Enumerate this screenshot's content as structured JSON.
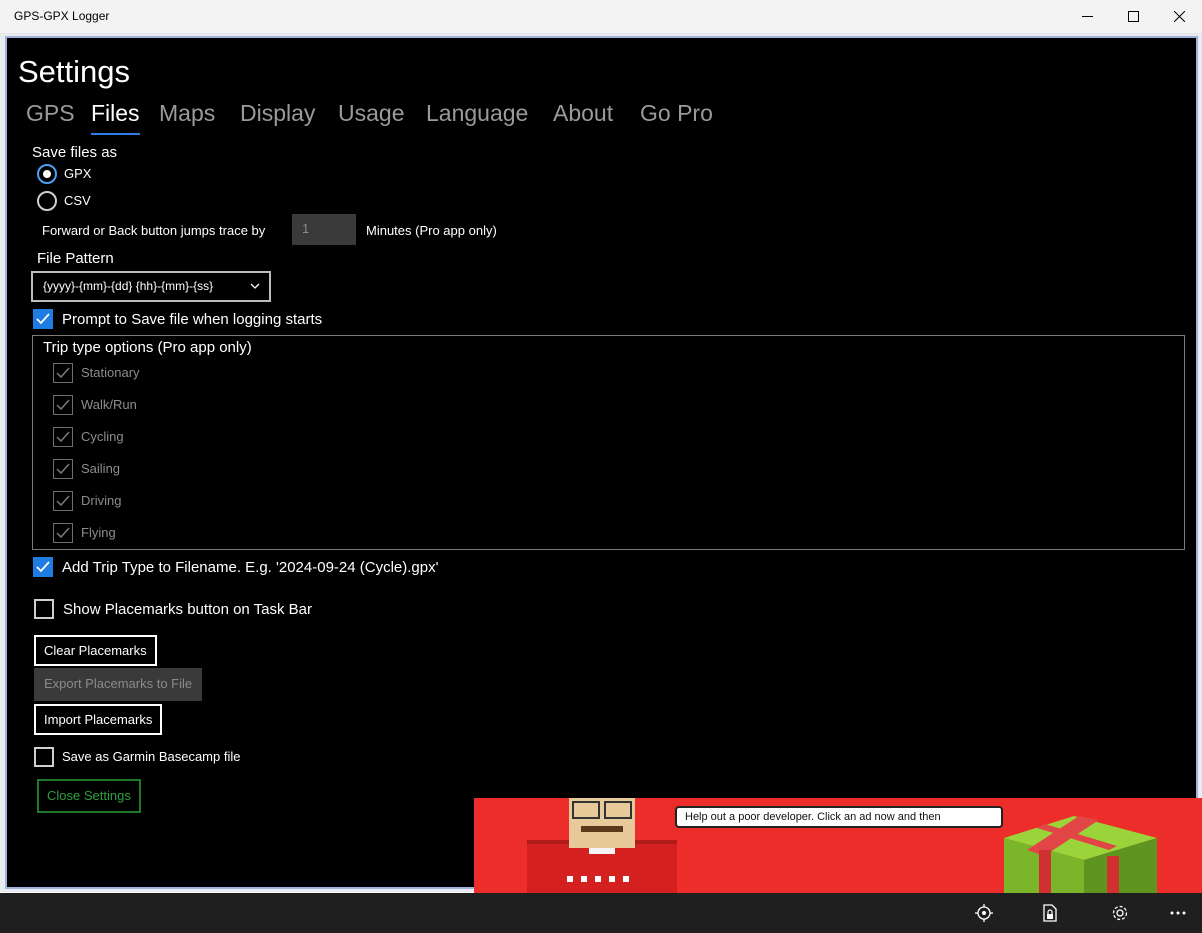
{
  "app": {
    "title": "GPS-GPX Logger"
  },
  "page": {
    "title": "Settings"
  },
  "tabs": [
    "GPS",
    "Files",
    "Maps",
    "Display",
    "Usage",
    "Language",
    "About",
    "Go Pro"
  ],
  "active_tab": "Files",
  "save_files": {
    "label": "Save files as",
    "options": [
      "GPX",
      "CSV"
    ],
    "selected": "GPX"
  },
  "jump": {
    "prefix": "Forward or Back button jumps trace by",
    "value": "1",
    "suffix": "Minutes (Pro app only)"
  },
  "file_pattern": {
    "label": "File Pattern",
    "value": "{yyyy}-{mm}-{dd} {hh}-{mm}-{ss}"
  },
  "prompt_save": {
    "label": "Prompt to Save file when logging starts",
    "checked": true
  },
  "trip_types": {
    "title": "Trip type options (Pro app only)",
    "items": [
      "Stationary",
      "Walk/Run",
      "Cycling",
      "Sailing",
      "Driving",
      "Flying"
    ]
  },
  "add_trip_type": {
    "label": "Add Trip Type to Filename. E.g. '2024-09-24 (Cycle).gpx'",
    "checked": true
  },
  "show_placemarks": {
    "label": "Show Placemarks button on Task Bar",
    "checked": false
  },
  "buttons": {
    "clear": "Clear Placemarks",
    "export": "Export Placemarks to File",
    "import": "Import Placemarks",
    "close": "Close Settings"
  },
  "garmin": {
    "label": "Save as Garmin Basecamp file",
    "checked": false
  },
  "ad": {
    "text": "Help out a poor developer.  Click an ad now and then"
  },
  "colors": {
    "accent": "#1e7ce3",
    "panel": "#000000",
    "ad_bg": "#ed2d2a",
    "close_green": "#2fa040"
  },
  "bottom_icons": [
    "locate-icon",
    "file-lock-icon",
    "gear-icon",
    "more-icon"
  ]
}
